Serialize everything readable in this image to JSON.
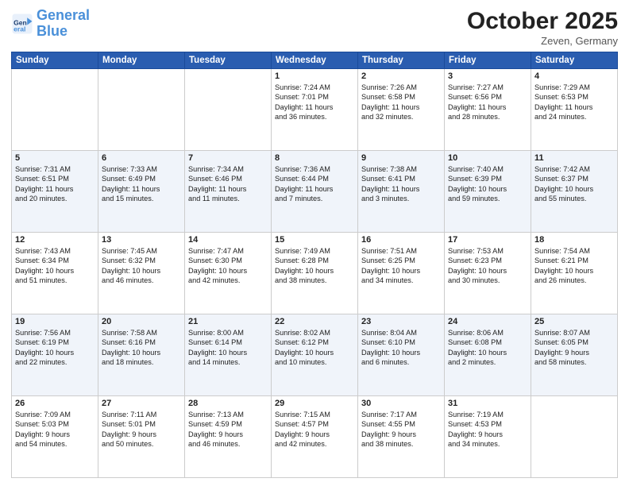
{
  "header": {
    "logo_line1": "General",
    "logo_line2": "Blue",
    "month": "October 2025",
    "location": "Zeven, Germany"
  },
  "weekdays": [
    "Sunday",
    "Monday",
    "Tuesday",
    "Wednesday",
    "Thursday",
    "Friday",
    "Saturday"
  ],
  "rows": [
    [
      {
        "empty": true
      },
      {
        "empty": true
      },
      {
        "empty": true
      },
      {
        "day": "1",
        "lines": [
          "Sunrise: 7:24 AM",
          "Sunset: 7:01 PM",
          "Daylight: 11 hours",
          "and 36 minutes."
        ]
      },
      {
        "day": "2",
        "lines": [
          "Sunrise: 7:26 AM",
          "Sunset: 6:58 PM",
          "Daylight: 11 hours",
          "and 32 minutes."
        ]
      },
      {
        "day": "3",
        "lines": [
          "Sunrise: 7:27 AM",
          "Sunset: 6:56 PM",
          "Daylight: 11 hours",
          "and 28 minutes."
        ]
      },
      {
        "day": "4",
        "lines": [
          "Sunrise: 7:29 AM",
          "Sunset: 6:53 PM",
          "Daylight: 11 hours",
          "and 24 minutes."
        ]
      }
    ],
    [
      {
        "day": "5",
        "lines": [
          "Sunrise: 7:31 AM",
          "Sunset: 6:51 PM",
          "Daylight: 11 hours",
          "and 20 minutes."
        ]
      },
      {
        "day": "6",
        "lines": [
          "Sunrise: 7:33 AM",
          "Sunset: 6:49 PM",
          "Daylight: 11 hours",
          "and 15 minutes."
        ]
      },
      {
        "day": "7",
        "lines": [
          "Sunrise: 7:34 AM",
          "Sunset: 6:46 PM",
          "Daylight: 11 hours",
          "and 11 minutes."
        ]
      },
      {
        "day": "8",
        "lines": [
          "Sunrise: 7:36 AM",
          "Sunset: 6:44 PM",
          "Daylight: 11 hours",
          "and 7 minutes."
        ]
      },
      {
        "day": "9",
        "lines": [
          "Sunrise: 7:38 AM",
          "Sunset: 6:41 PM",
          "Daylight: 11 hours",
          "and 3 minutes."
        ]
      },
      {
        "day": "10",
        "lines": [
          "Sunrise: 7:40 AM",
          "Sunset: 6:39 PM",
          "Daylight: 10 hours",
          "and 59 minutes."
        ]
      },
      {
        "day": "11",
        "lines": [
          "Sunrise: 7:42 AM",
          "Sunset: 6:37 PM",
          "Daylight: 10 hours",
          "and 55 minutes."
        ]
      }
    ],
    [
      {
        "day": "12",
        "lines": [
          "Sunrise: 7:43 AM",
          "Sunset: 6:34 PM",
          "Daylight: 10 hours",
          "and 51 minutes."
        ]
      },
      {
        "day": "13",
        "lines": [
          "Sunrise: 7:45 AM",
          "Sunset: 6:32 PM",
          "Daylight: 10 hours",
          "and 46 minutes."
        ]
      },
      {
        "day": "14",
        "lines": [
          "Sunrise: 7:47 AM",
          "Sunset: 6:30 PM",
          "Daylight: 10 hours",
          "and 42 minutes."
        ]
      },
      {
        "day": "15",
        "lines": [
          "Sunrise: 7:49 AM",
          "Sunset: 6:28 PM",
          "Daylight: 10 hours",
          "and 38 minutes."
        ]
      },
      {
        "day": "16",
        "lines": [
          "Sunrise: 7:51 AM",
          "Sunset: 6:25 PM",
          "Daylight: 10 hours",
          "and 34 minutes."
        ]
      },
      {
        "day": "17",
        "lines": [
          "Sunrise: 7:53 AM",
          "Sunset: 6:23 PM",
          "Daylight: 10 hours",
          "and 30 minutes."
        ]
      },
      {
        "day": "18",
        "lines": [
          "Sunrise: 7:54 AM",
          "Sunset: 6:21 PM",
          "Daylight: 10 hours",
          "and 26 minutes."
        ]
      }
    ],
    [
      {
        "day": "19",
        "lines": [
          "Sunrise: 7:56 AM",
          "Sunset: 6:19 PM",
          "Daylight: 10 hours",
          "and 22 minutes."
        ]
      },
      {
        "day": "20",
        "lines": [
          "Sunrise: 7:58 AM",
          "Sunset: 6:16 PM",
          "Daylight: 10 hours",
          "and 18 minutes."
        ]
      },
      {
        "day": "21",
        "lines": [
          "Sunrise: 8:00 AM",
          "Sunset: 6:14 PM",
          "Daylight: 10 hours",
          "and 14 minutes."
        ]
      },
      {
        "day": "22",
        "lines": [
          "Sunrise: 8:02 AM",
          "Sunset: 6:12 PM",
          "Daylight: 10 hours",
          "and 10 minutes."
        ]
      },
      {
        "day": "23",
        "lines": [
          "Sunrise: 8:04 AM",
          "Sunset: 6:10 PM",
          "Daylight: 10 hours",
          "and 6 minutes."
        ]
      },
      {
        "day": "24",
        "lines": [
          "Sunrise: 8:06 AM",
          "Sunset: 6:08 PM",
          "Daylight: 10 hours",
          "and 2 minutes."
        ]
      },
      {
        "day": "25",
        "lines": [
          "Sunrise: 8:07 AM",
          "Sunset: 6:05 PM",
          "Daylight: 9 hours",
          "and 58 minutes."
        ]
      }
    ],
    [
      {
        "day": "26",
        "lines": [
          "Sunrise: 7:09 AM",
          "Sunset: 5:03 PM",
          "Daylight: 9 hours",
          "and 54 minutes."
        ]
      },
      {
        "day": "27",
        "lines": [
          "Sunrise: 7:11 AM",
          "Sunset: 5:01 PM",
          "Daylight: 9 hours",
          "and 50 minutes."
        ]
      },
      {
        "day": "28",
        "lines": [
          "Sunrise: 7:13 AM",
          "Sunset: 4:59 PM",
          "Daylight: 9 hours",
          "and 46 minutes."
        ]
      },
      {
        "day": "29",
        "lines": [
          "Sunrise: 7:15 AM",
          "Sunset: 4:57 PM",
          "Daylight: 9 hours",
          "and 42 minutes."
        ]
      },
      {
        "day": "30",
        "lines": [
          "Sunrise: 7:17 AM",
          "Sunset: 4:55 PM",
          "Daylight: 9 hours",
          "and 38 minutes."
        ]
      },
      {
        "day": "31",
        "lines": [
          "Sunrise: 7:19 AM",
          "Sunset: 4:53 PM",
          "Daylight: 9 hours",
          "and 34 minutes."
        ]
      },
      {
        "empty": true
      }
    ]
  ]
}
